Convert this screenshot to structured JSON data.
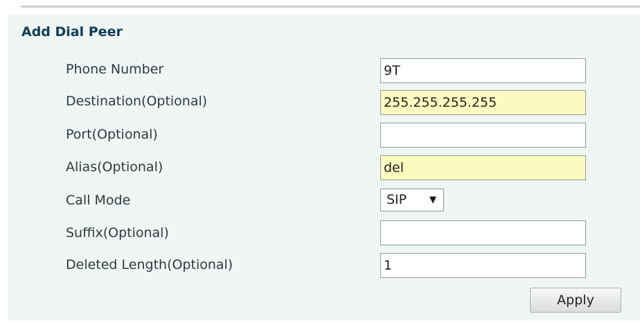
{
  "form": {
    "title": "Add Dial Peer",
    "fields": [
      {
        "label": "Phone Number",
        "value": "9T"
      },
      {
        "label": "Destination(Optional)",
        "value": "255.255.255.255"
      },
      {
        "label": "Port(Optional)",
        "value": ""
      },
      {
        "label": "Alias(Optional)",
        "value": "del"
      },
      {
        "label": "Call Mode",
        "value": "SIP"
      },
      {
        "label": "Suffix(Optional)",
        "value": ""
      },
      {
        "label": "Deleted Length(Optional)",
        "value": "1"
      }
    ],
    "highlight_color": "#fbfbbf",
    "apply_label": "Apply"
  }
}
